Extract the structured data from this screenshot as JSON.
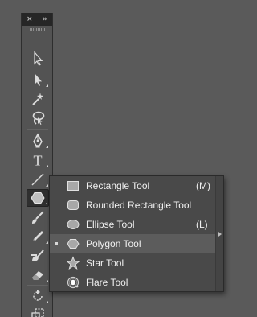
{
  "panel": {
    "close_glyph": "×",
    "collapse_glyph": "»"
  },
  "tools": [
    {
      "name": "selection-tool-icon"
    },
    {
      "name": "direct-selection-tool-icon"
    },
    {
      "name": "magic-wand-tool-icon"
    },
    {
      "name": "lasso-tool-icon"
    },
    {
      "name": "pen-tool-icon"
    },
    {
      "name": "type-tool-icon",
      "glyph": "T"
    },
    {
      "name": "line-segment-tool-icon"
    },
    {
      "name": "polygon-tool-icon",
      "active": true
    },
    {
      "name": "paintbrush-tool-icon"
    },
    {
      "name": "pencil-tool-icon"
    },
    {
      "name": "blob-brush-tool-icon"
    },
    {
      "name": "eraser-tool-icon"
    },
    {
      "name": "rotate-tool-icon"
    },
    {
      "name": "scale-tool-icon"
    }
  ],
  "flyout": {
    "items": [
      {
        "label": "Rectangle Tool",
        "shortcut": "(M)",
        "icon": "rectangle-icon"
      },
      {
        "label": "Rounded Rectangle Tool",
        "shortcut": "",
        "icon": "rounded-rectangle-icon"
      },
      {
        "label": "Ellipse Tool",
        "shortcut": "(L)",
        "icon": "ellipse-icon"
      },
      {
        "label": "Polygon Tool",
        "shortcut": "",
        "icon": "polygon-icon",
        "selected": true
      },
      {
        "label": "Star Tool",
        "shortcut": "",
        "icon": "star-icon"
      },
      {
        "label": "Flare Tool",
        "shortcut": "",
        "icon": "flare-icon"
      }
    ]
  },
  "colors": {
    "panel_bg": "#535353",
    "menu_bg": "#494949",
    "menu_selected": "#5c5c5c",
    "text": "#f0f0f0"
  }
}
